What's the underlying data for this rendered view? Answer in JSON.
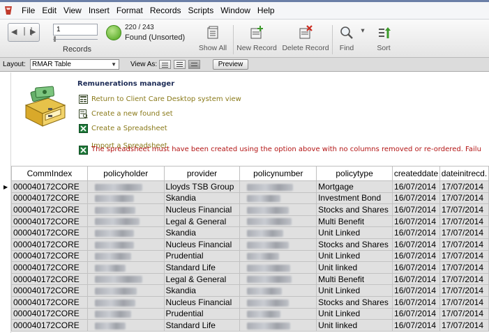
{
  "menu": [
    "File",
    "Edit",
    "View",
    "Insert",
    "Format",
    "Records",
    "Scripts",
    "Window",
    "Help"
  ],
  "toolbar": {
    "record_number": "1",
    "records_label": "Records",
    "found_count": "220 / 243",
    "found_status": "Found (Unsorted)",
    "show_all": "Show All",
    "new_record": "New Record",
    "delete_record": "Delete Record",
    "find": "Find",
    "sort": "Sort"
  },
  "layoutbar": {
    "layout_label": "Layout:",
    "layout_value": "RMAR Table",
    "view_as": "View As:",
    "preview": "Preview"
  },
  "panel": {
    "title": "Remunerations manager",
    "actions": [
      "Return to Client Care Desktop system view",
      "Create a new found set",
      "Create a Spreadsheet",
      "Import a Spreadsheet"
    ],
    "warning": "The spreadsheet must have been created using the option above with no columns removed or re-ordered. Failu"
  },
  "table": {
    "columns": [
      "CommIndex",
      "policyholder",
      "provider",
      "policynumber",
      "policytype",
      "createddate",
      "dateinitrecd."
    ],
    "rows": [
      [
        "000040172CORE",
        "Lloyds TSB Group",
        "Mortgage",
        "16/07/2014",
        "17/07/2014"
      ],
      [
        "000040172CORE",
        "Skandia",
        "Investment Bond",
        "16/07/2014",
        "17/07/2014"
      ],
      [
        "000040172CORE",
        "Nucleus Financial",
        "Stocks and Shares",
        "16/07/2014",
        "17/07/2014"
      ],
      [
        "000040172CORE",
        "Legal & General",
        "Multi Benefit",
        "16/07/2014",
        "17/07/2014"
      ],
      [
        "000040172CORE",
        "Skandia",
        "Unit Linked",
        "16/07/2014",
        "17/07/2014"
      ],
      [
        "000040172CORE",
        "Nucleus Financial",
        "Stocks and Shares",
        "16/07/2014",
        "17/07/2014"
      ],
      [
        "000040172CORE",
        "Prudential",
        "Unit Linked",
        "16/07/2014",
        "17/07/2014"
      ],
      [
        "000040172CORE",
        "Standard Life",
        "Unit linked",
        "16/07/2014",
        "17/07/2014"
      ],
      [
        "000040172CORE",
        "Legal & General",
        "Multi Benefit",
        "16/07/2014",
        "17/07/2014"
      ],
      [
        "000040172CORE",
        "Skandia",
        "Unit Linked",
        "16/07/2014",
        "17/07/2014"
      ],
      [
        "000040172CORE",
        "Nucleus Financial",
        "Stocks and Shares",
        "16/07/2014",
        "17/07/2014"
      ],
      [
        "000040172CORE",
        "Prudential",
        "Unit Linked",
        "16/07/2014",
        "17/07/2014"
      ],
      [
        "000040172CORE",
        "Standard Life",
        "Unit linked",
        "16/07/2014",
        "17/07/2014"
      ]
    ]
  },
  "colors": {
    "panel_title": "#1b2a55",
    "action_text": "#8a7a1a",
    "warning_text": "#b31414",
    "row_bg": "#e0e0e0"
  }
}
